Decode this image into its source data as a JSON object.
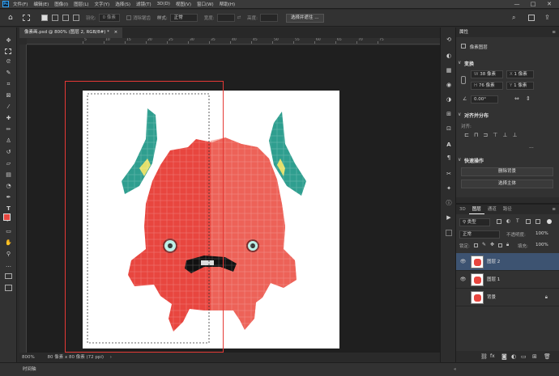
{
  "menu": {
    "logo": "Ps",
    "items": [
      "文件(F)",
      "编辑(E)",
      "图像(I)",
      "图层(L)",
      "文字(Y)",
      "选择(S)",
      "滤镜(T)",
      "3D(D)",
      "视图(V)",
      "窗口(W)",
      "帮助(H)"
    ],
    "window_controls": [
      "—",
      "□",
      "✕"
    ]
  },
  "options_bar": {
    "feather_label": "羽化:",
    "feather_value": "0 像素",
    "antialias_label": "消除锯齿",
    "style_label": "样式:",
    "style_value": "正常",
    "width_label": "宽度:",
    "height_label": "高度:",
    "select_mask_button": "选择并遮住 ..."
  },
  "document": {
    "tab_title": "像素画.psd @ 800% (图层 2, RGB/8#) *",
    "tab_close": "×"
  },
  "ruler": {
    "top_marks": [
      "5",
      "10",
      "15",
      "20",
      "25",
      "30",
      "35",
      "40",
      "45",
      "50",
      "55",
      "60",
      "65",
      "70",
      "75"
    ]
  },
  "status": {
    "zoom": "800%",
    "size": "80 像素 x 80 像素 (72 ppi)",
    "arrow": "›"
  },
  "timeline": {
    "label": "时间轴"
  },
  "properties": {
    "tab": "属性",
    "layer_type": "像素图层",
    "transform_title": "变换",
    "w_label": "W",
    "w_value": "38 像素",
    "h_label": "H",
    "h_value": "76 像素",
    "x_label": "X",
    "x_value": "1 像素",
    "y_label": "Y",
    "y_value": "1 像素",
    "angle_value": "0.00°",
    "align_title": "对齐并分布",
    "align_label": "对齐:",
    "more": "...",
    "quick_actions_title": "快速操作",
    "remove_bg_button": "删除背景",
    "select_subject_button": "选择主体"
  },
  "layers_panel": {
    "tabs": [
      "3D",
      "图层",
      "通道",
      "路径"
    ],
    "active_tab": "图层",
    "filter_value": "类型",
    "blend_mode": "正常",
    "opacity_label": "不透明度:",
    "opacity_value": "100%",
    "lock_label": "锁定:",
    "fill_label": "填充:",
    "fill_value": "100%",
    "layers": [
      {
        "name": "图层 2",
        "selected": true,
        "visible": true
      },
      {
        "name": "图层 1",
        "selected": false,
        "visible": true
      },
      {
        "name": "背景",
        "selected": false,
        "visible": false
      }
    ]
  },
  "colors": {
    "monster": "#e8463f",
    "monster_light": "#f07a6e",
    "horn": "#2f9e8f",
    "horn_highlight": "#e3e06b",
    "selection_rect": "#e53935",
    "layer_selected": "#3d5371"
  }
}
